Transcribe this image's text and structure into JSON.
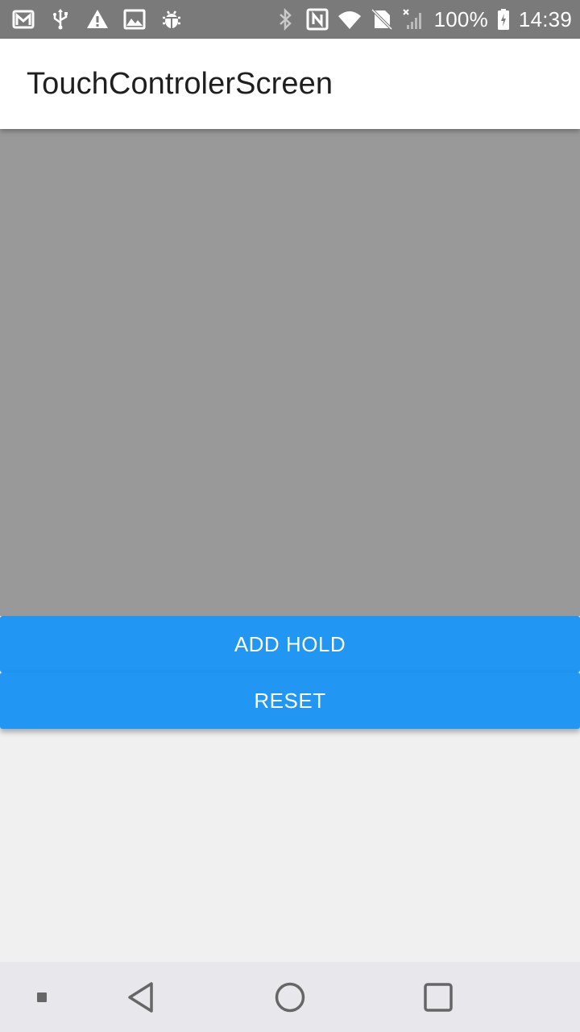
{
  "status_bar": {
    "battery_text": "100%",
    "time": "14:39",
    "left_icons": [
      "gmail-icon",
      "usb-icon",
      "warning-icon",
      "image-icon",
      "android-debug-icon"
    ],
    "right_icons": [
      "bluetooth-icon",
      "nfc-icon",
      "wifi-icon",
      "no-sim-icon",
      "signal-icon",
      "battery-charging-icon"
    ]
  },
  "app_bar": {
    "title": "TouchControlerScreen"
  },
  "buttons": {
    "add_hold": "ADD HOLD",
    "reset": "RESET"
  },
  "nav_bar": {
    "items": [
      "menu-dot-icon",
      "back-icon",
      "home-icon",
      "recents-icon"
    ]
  },
  "colors": {
    "status_bar": "#7a7a7a",
    "app_bar": "#ffffff",
    "touch_area": "#999999",
    "accent_button": "#2196f3",
    "background": "#f0f0f0",
    "nav_bar": "#e8e8ec"
  }
}
